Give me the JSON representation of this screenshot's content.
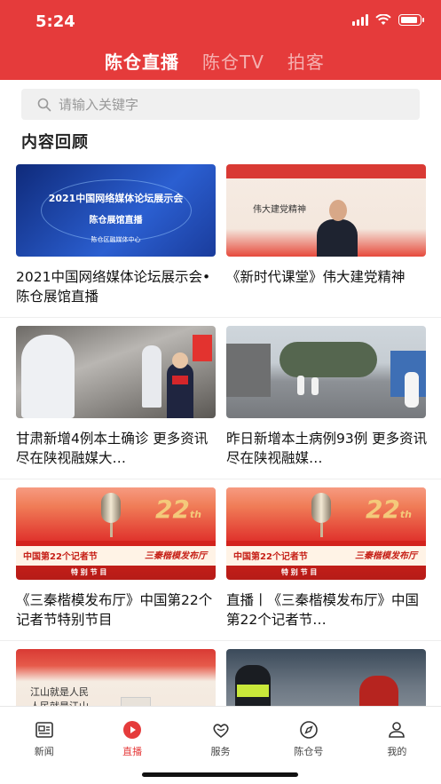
{
  "status_bar": {
    "time": "5:24",
    "battery_level": 0.9
  },
  "header": {
    "tabs": [
      {
        "label": "陈仓直播",
        "active": true
      },
      {
        "label": "陈仓TV",
        "active": false
      },
      {
        "label": "拍客",
        "active": false
      }
    ]
  },
  "search": {
    "placeholder": "请输入关键字",
    "icon": "search-icon"
  },
  "section_title": "内容回顾",
  "items": [
    {
      "caption": "2021中国网络媒体论坛展示会•陈仓展馆直播",
      "thumb_lines": [
        "2021中国网络媒体论坛展示会",
        "陈仓展馆直播",
        "陈仓区融媒体中心"
      ]
    },
    {
      "caption": "《新时代课堂》伟大建党精神",
      "thumb_lines": [
        "伟大建党精神"
      ]
    },
    {
      "caption": "甘肃新增4例本土确诊 更多资讯尽在陕视融媒大…",
      "thumb_lines": []
    },
    {
      "caption": "昨日新增本土病例93例 更多资讯尽在陕视融媒…",
      "thumb_lines": []
    },
    {
      "caption": "《三秦楷模发布厅》中国第22个记者节特别节目",
      "thumb_lines": [
        "中国第22个记者节",
        "特 别 节 目",
        "三秦楷模发布厅",
        "22",
        "th"
      ]
    },
    {
      "caption": "直播丨《三秦楷模发布厅》中国第22个记者节…",
      "thumb_lines": [
        "中国第22个记者节",
        "特 别 节 目",
        "三秦楷模发布厅",
        "22",
        "th"
      ]
    },
    {
      "caption": "",
      "thumb_lines": [
        "江山就是人民",
        "人民就是江山"
      ]
    },
    {
      "caption": "",
      "thumb_lines": []
    }
  ],
  "bottom_nav": [
    {
      "label": "新闻",
      "icon": "news-icon",
      "active": false
    },
    {
      "label": "直播",
      "icon": "play-icon",
      "active": true
    },
    {
      "label": "服务",
      "icon": "service-heart-icon",
      "active": false
    },
    {
      "label": "陈仓号",
      "icon": "compass-icon",
      "active": false
    },
    {
      "label": "我的",
      "icon": "profile-icon",
      "active": false
    }
  ],
  "colors": {
    "accent": "#e53b3b",
    "tab_inactive": "rgba(255,255,255,0.6)",
    "text": "#111111"
  }
}
